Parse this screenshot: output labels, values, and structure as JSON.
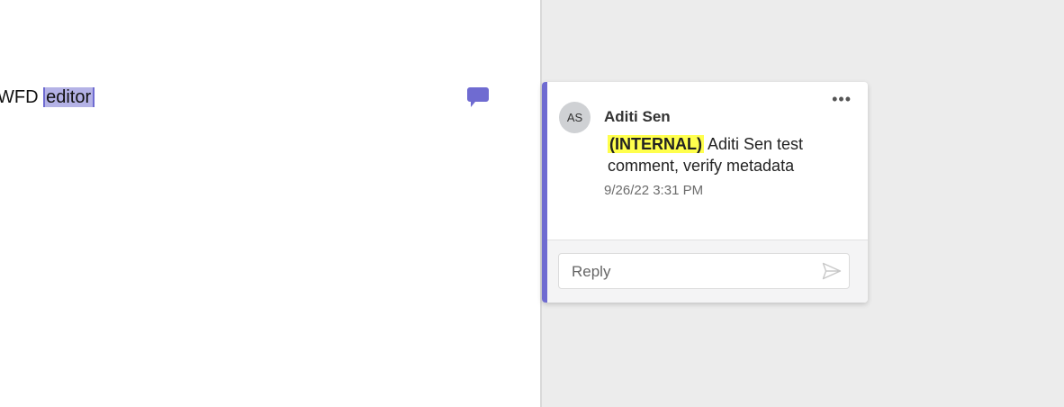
{
  "document": {
    "text_before": "WFD ",
    "selected_text": "editor"
  },
  "comment_marker": {
    "icon": "comment-bubble-icon",
    "color": "#6f6bd1"
  },
  "comment": {
    "avatar_initials": "AS",
    "author": "Aditi Sen",
    "tag": "(INTERNAL)",
    "body": " Aditi Sen test comment, verify metadata",
    "timestamp": "9/26/22 3:31 PM",
    "more_icon": "more-horizontal-icon",
    "more_label": "•••"
  },
  "reply": {
    "placeholder": "Reply",
    "send_icon": "send-icon"
  },
  "colors": {
    "accent": "#6f6bd1",
    "highlight": "#ffff4d",
    "selection": "#b4b2e6"
  }
}
